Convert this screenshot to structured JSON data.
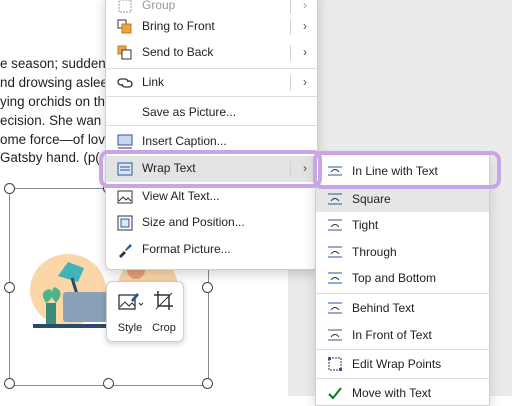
{
  "document": {
    "lines": [
      "e season; sudden",
      "nd drowsing aslee",
      "ying orchids on th",
      "ecision. She wan",
      "ome force—of lov",
      "Gatsby hand. (p("
    ]
  },
  "context_menu": {
    "items": [
      {
        "label": "Group",
        "icon": "group-icon",
        "has_submenu": true
      },
      {
        "label": "Bring to Front",
        "icon": "bring-to-front-icon",
        "has_submenu": true
      },
      {
        "label": "Send to Back",
        "icon": "send-to-back-icon",
        "has_submenu": true
      },
      {
        "label": "Link",
        "icon": "link-icon",
        "has_submenu": true
      },
      {
        "label": "Save as Picture...",
        "icon": "",
        "has_submenu": false
      },
      {
        "label": "Insert Caption...",
        "icon": "insert-caption-icon",
        "has_submenu": false
      },
      {
        "label": "Wrap Text",
        "icon": "wrap-text-icon",
        "has_submenu": true
      },
      {
        "label": "View Alt Text...",
        "icon": "alt-text-icon",
        "has_submenu": false
      },
      {
        "label": "Size and Position...",
        "icon": "size-position-icon",
        "has_submenu": false
      },
      {
        "label": "Format Picture...",
        "icon": "format-picture-icon",
        "has_submenu": false
      }
    ]
  },
  "wrap_submenu": {
    "items": [
      {
        "label": "In Line with Text",
        "icon": "inline-with-text-icon"
      },
      {
        "label": "Square",
        "icon": "square-wrap-icon",
        "selected": true
      },
      {
        "label": "Tight",
        "icon": "tight-wrap-icon"
      },
      {
        "label": "Through",
        "icon": "through-wrap-icon"
      },
      {
        "label": "Top and Bottom",
        "icon": "top-bottom-wrap-icon"
      },
      {
        "label": "Behind Text",
        "icon": "behind-text-icon"
      },
      {
        "label": "In Front of Text",
        "icon": "in-front-of-text-icon"
      },
      {
        "label": "Edit Wrap Points",
        "icon": "edit-wrap-points-icon"
      },
      {
        "label": "Move with Text",
        "icon": "checkmark-icon",
        "checked": true
      }
    ]
  },
  "mini_toolbar": {
    "style_label": "Style",
    "crop_label": "Crop"
  },
  "colors": {
    "highlight_ring": "#c8a6e6",
    "accent_blue": "#2b5797",
    "check_green": "#107c10"
  }
}
